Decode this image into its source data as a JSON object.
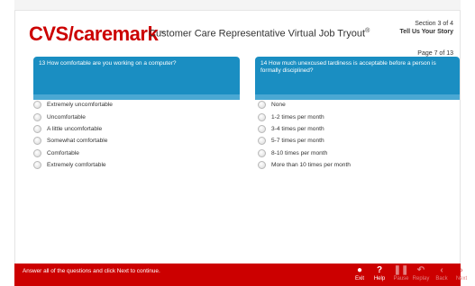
{
  "header": {
    "logo_text": "CVS/caremark",
    "logo_tm": "™",
    "title": "Customer Care Representative Virtual Job Tryout",
    "title_reg": "®",
    "section": "Section 3 of 4",
    "story": "Tell Us Your Story",
    "page": "Page  7 of 13"
  },
  "questions": [
    {
      "label": "13  How comfortable are you working on a computer?",
      "options": [
        "Extremely uncomfortable",
        "Uncomfortable",
        "A little uncomfortable",
        "Somewhat comfortable",
        "Comfortable",
        "Extremely comfortable"
      ]
    },
    {
      "label": "14  How much unexcused tardiness is acceptable before a person is formally disciplined?",
      "options": [
        "None",
        "1-2 times per month",
        "3-4 times per month",
        "5-7 times per month",
        "8-10 times per month",
        "More than 10 times per month"
      ]
    }
  ],
  "footer": {
    "message": "Answer all of the questions and click Next to continue.",
    "buttons": {
      "exit": "Exit",
      "help": "Help",
      "pause": "Pause",
      "replay": "Replay",
      "back": "Back",
      "next": "Next"
    }
  },
  "colors": {
    "brand_red": "#cc0000",
    "question_blue": "#1a8ec2"
  },
  "icons": {
    "exit": "exit-icon",
    "help": "help-icon",
    "pause": "pause-icon",
    "replay": "replay-icon",
    "back": "back-arrow-icon",
    "next": "next-arrow-icon"
  }
}
